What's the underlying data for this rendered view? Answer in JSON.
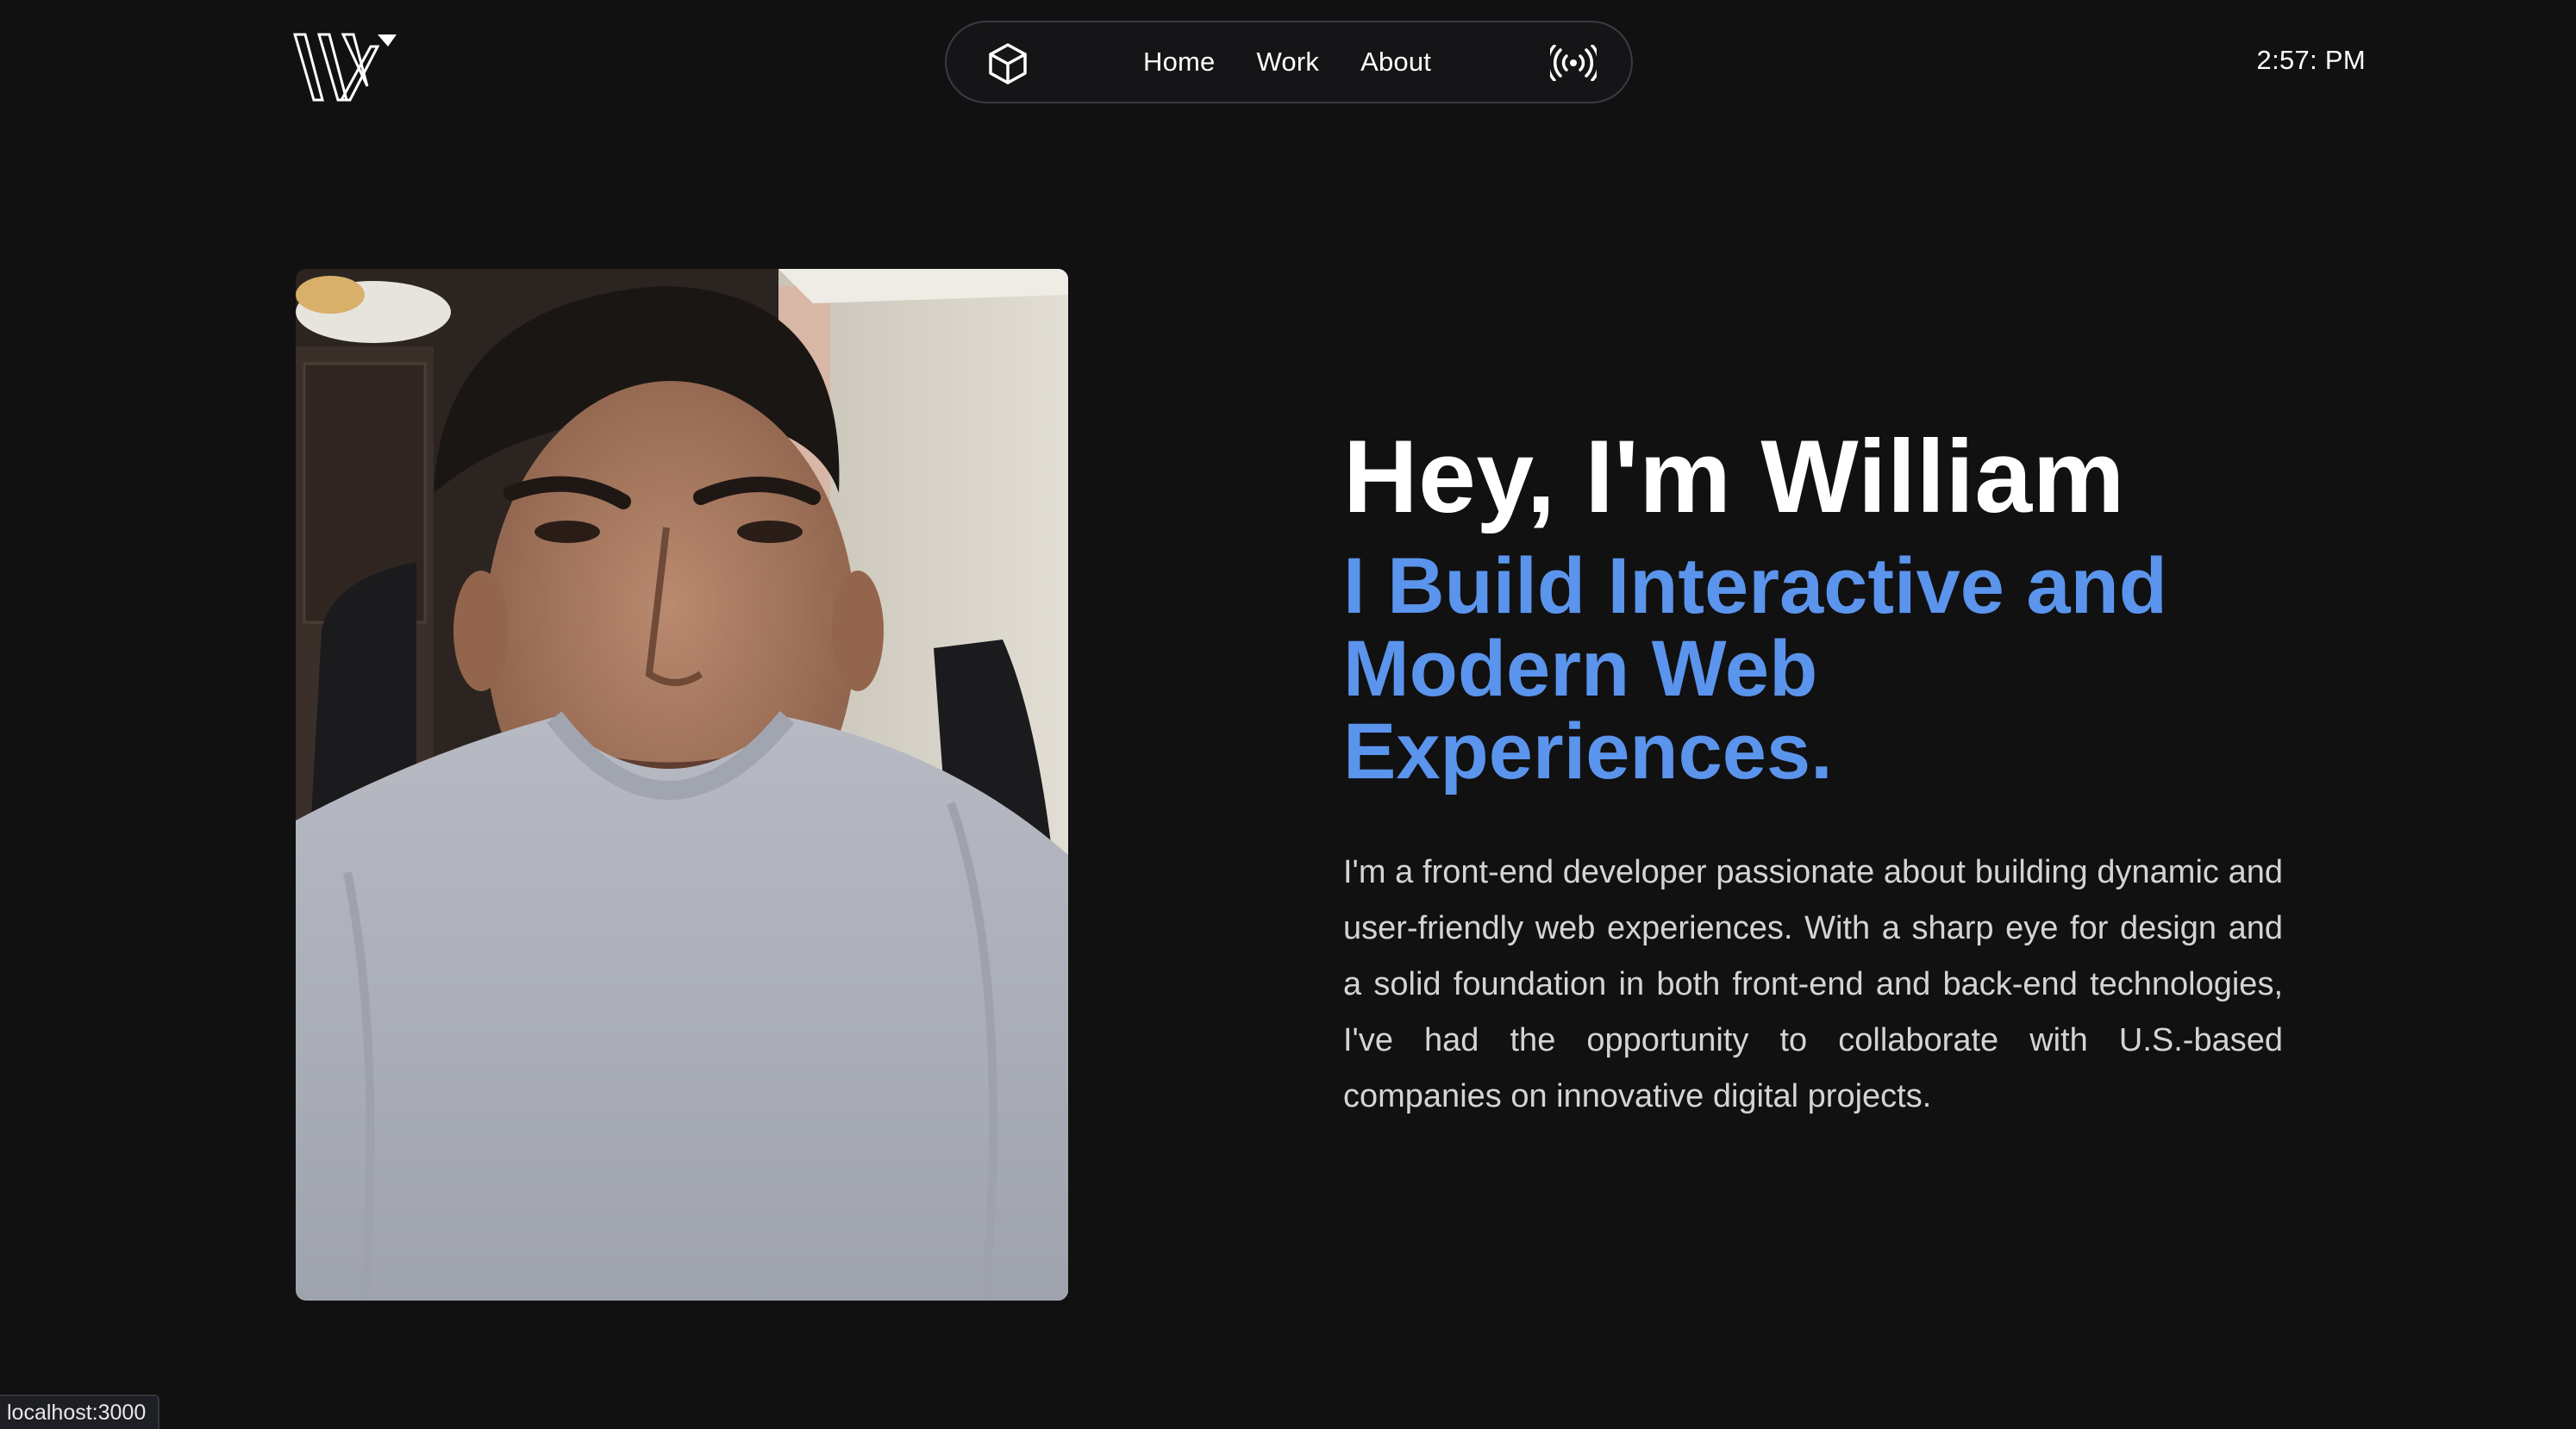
{
  "header": {
    "logo_icon": "w-monogram-logo",
    "nav": {
      "cube_icon": "cube-icon",
      "links": [
        {
          "label": "Home"
        },
        {
          "label": "Work"
        },
        {
          "label": "About"
        }
      ],
      "broadcast_icon": "broadcast-icon"
    },
    "clock": "2:57: PM"
  },
  "hero": {
    "portrait_icon": "profile-photo",
    "title": "Hey, I'm William",
    "subtitle": "I Build Interactive and Modern Web Experiences.",
    "description": "I'm a front-end developer passionate about building dynamic and user-friendly web experiences. With a sharp eye for design and a solid foundation in both front-end and back-end technologies, I've had the opportunity to collaborate with U.S.-based companies on innovative digital projects."
  },
  "status_bar": {
    "url": "localhost:3000"
  },
  "colors": {
    "background": "#111112",
    "accent": "#5b94ec",
    "text": "#ffffff",
    "muted_text": "#d4d4d6",
    "nav_border": "#3a3b44"
  }
}
